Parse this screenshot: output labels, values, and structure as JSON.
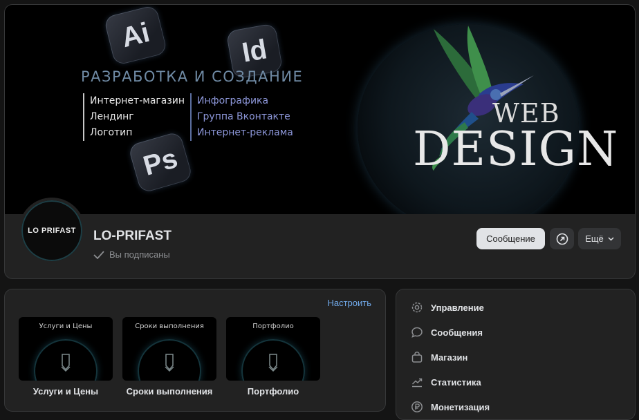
{
  "cover": {
    "heading": "РАЗРАБОТКА И СОЗДАНИЕ",
    "left_services": [
      "Интернет-магазин",
      "Лендинг",
      "Логотип"
    ],
    "right_services": [
      "Инфографика",
      "Группа Вконтакте",
      "Интернет-реклама"
    ],
    "app_tiles": [
      "Ai",
      "Id",
      "Ps"
    ],
    "web_text": "WEB",
    "design_text": "DESIGN"
  },
  "profile": {
    "avatar_text": "LO PRIFAST",
    "name": "LO-PRIFAST",
    "status": "Вы подписаны"
  },
  "actions": {
    "message_label": "Сообщение",
    "more_label": "Ещё"
  },
  "links": {
    "configure_label": "Настроить",
    "items": [
      {
        "thumb_label": "Услуги и Цены",
        "caption": "Услуги и Цены"
      },
      {
        "thumb_label": "Сроки выполнения",
        "caption": "Сроки выполнения"
      },
      {
        "thumb_label": "Портфолио",
        "caption": "Портфолио"
      }
    ]
  },
  "menu": {
    "items": [
      {
        "label": "Управление",
        "icon": "gear-icon"
      },
      {
        "label": "Сообщения",
        "icon": "chat-bubble-icon"
      },
      {
        "label": "Магазин",
        "icon": "shopping-bag-icon"
      },
      {
        "label": "Статистика",
        "icon": "trend-chart-icon"
      },
      {
        "label": "Монетизация",
        "icon": "ruble-coin-icon"
      }
    ]
  },
  "colors": {
    "page_background": "#141414",
    "card_background": "#222222",
    "accent_link": "#71aaeb",
    "primary_button": "#e1e3e6",
    "secondary_button": "#333436"
  }
}
